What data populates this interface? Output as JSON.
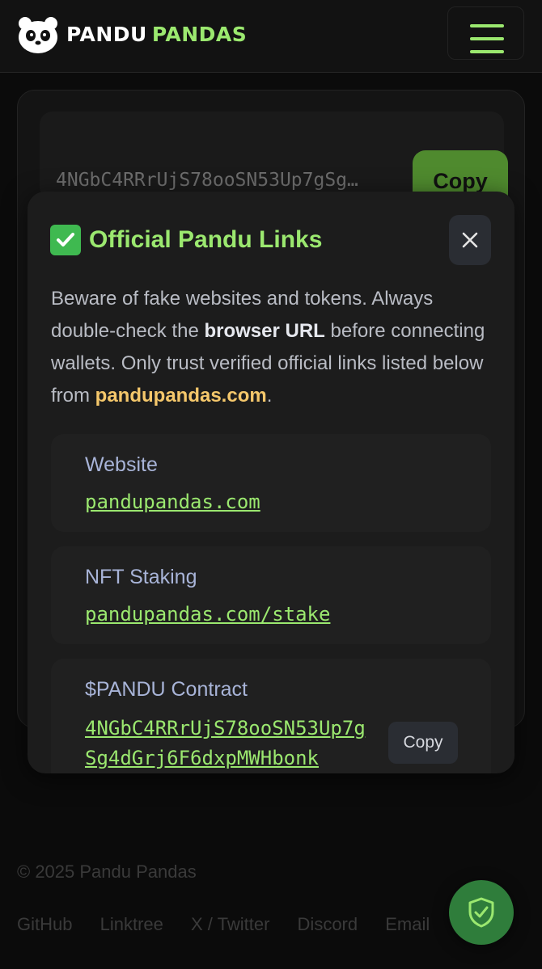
{
  "header": {
    "brand_word1": "PANDU",
    "brand_word2": "PANDAS",
    "menu_icon": "hamburger-menu-icon",
    "logo_icon": "panda-face-icon"
  },
  "background": {
    "contract_address": "4NGbC4RRrUjS78ooSN53Up7gSg4dGrj6F6dxpMWHbonk",
    "copy_label": "Copy"
  },
  "modal": {
    "title_icon": "check-mark-icon",
    "title": "Official Pandu Links",
    "close_icon": "close-icon",
    "warning": {
      "part1": "Beware of fake websites and tokens. Always double-check the ",
      "bold": "browser URL",
      "part2": " before connecting wallets. Only trust verified official links listed below from ",
      "domain": "pandupandas.com",
      "part3": "."
    },
    "links": [
      {
        "label": "Website",
        "url": "pandupandas.com"
      },
      {
        "label": "NFT Staking",
        "url": "pandupandas.com/stake"
      }
    ],
    "contract": {
      "label": "$PANDU Contract",
      "address": "4NGbC4RRrUjS78ooSN53Up7gSg4dGrj6F6dxpMWHbonk",
      "copy_label": "Copy"
    }
  },
  "footer": {
    "copyright": "© 2025 Pandu Pandas",
    "links": [
      "GitHub",
      "Linktree",
      "X / Twitter",
      "Discord",
      "Email"
    ],
    "shield_icon": "shield-check-icon"
  },
  "colors": {
    "accent_green": "#9be86f",
    "gold": "#f4c76b",
    "button_green": "#4f8a2e"
  }
}
